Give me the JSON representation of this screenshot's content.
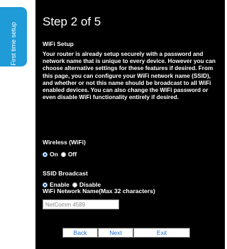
{
  "sidebar": {
    "tab_label": "First time setup"
  },
  "header": {
    "step_title": "Step 2 of 5"
  },
  "wifi_setup": {
    "title": "WiFi Setup",
    "description": "Your router is already setup securely with a password and network name that is unique to every device. However you can choose alternative settings for these features if desired. From this page, you can configure your WiFi network name (SSID), and whether or not this name should be broadcast to all WiFi enabled devices. You can also change the WiFi password or even disable WiFi functionality entirely if desired."
  },
  "wireless": {
    "title": "Wireless (WiFi)",
    "options": [
      {
        "label": "On",
        "selected": true
      },
      {
        "label": "Off",
        "selected": false
      }
    ]
  },
  "ssid_broadcast": {
    "title": "SSID Broadcast",
    "options": [
      {
        "label": "Enable",
        "selected": true
      },
      {
        "label": "Disable",
        "selected": false
      }
    ]
  },
  "network_name": {
    "title": "WiFi Network Name(Max 32 characters)",
    "value": "NetComm 4589"
  },
  "buttons": {
    "back": "Back",
    "next": "Next",
    "exit": "Exit"
  },
  "colors": {
    "accent": "#1f9bd7",
    "panel_bg": "#000000",
    "button_text": "#1f6fd1"
  }
}
